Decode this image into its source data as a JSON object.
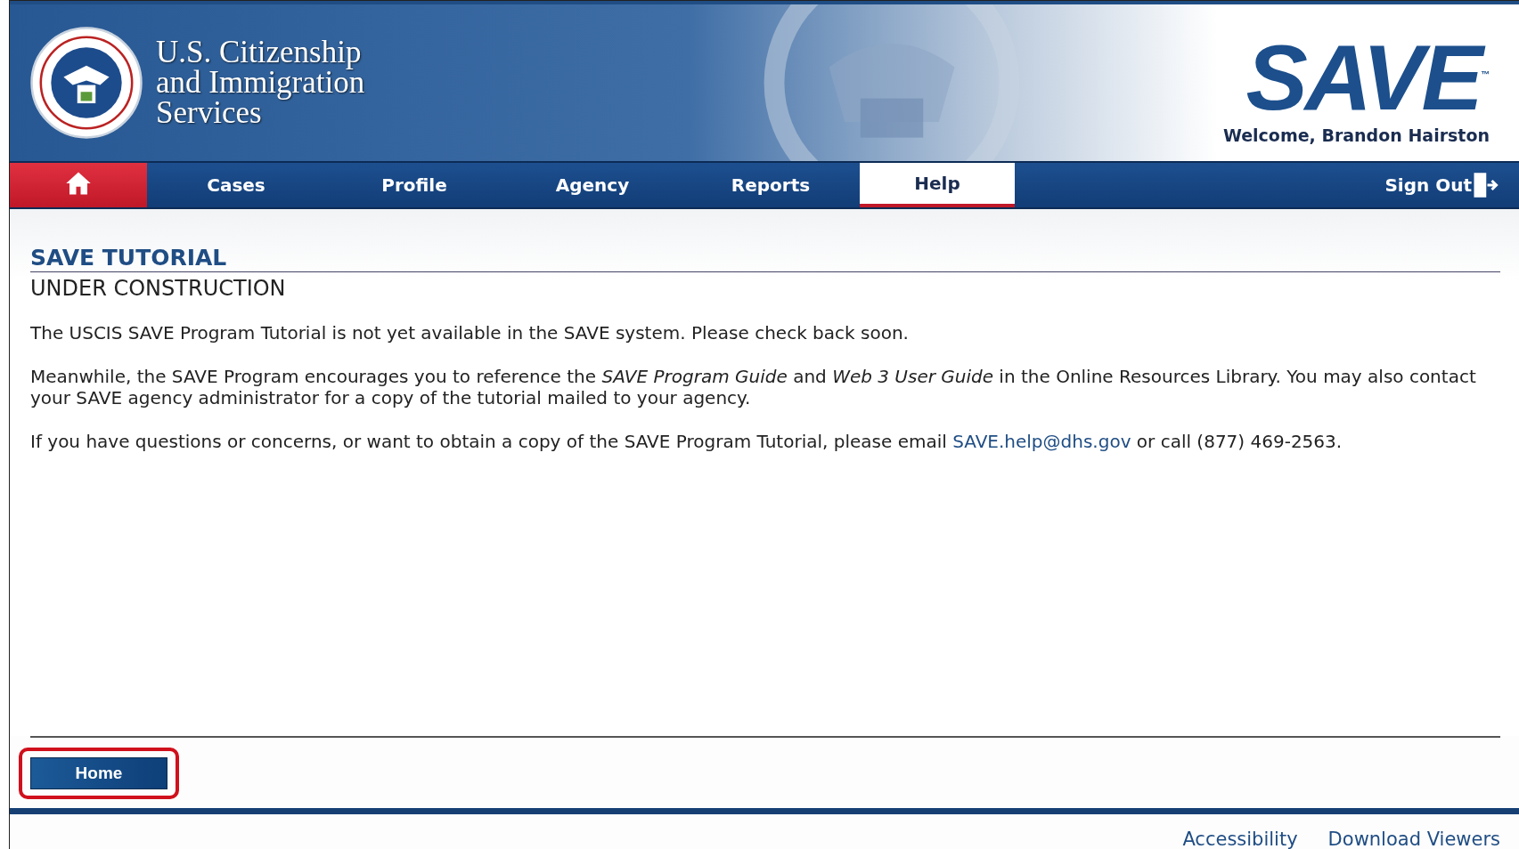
{
  "header": {
    "agency_name": [
      "U.S. Citizenship",
      "and Immigration",
      "Services"
    ],
    "logo_text": "SAVE",
    "trademark": "™",
    "welcome": "Welcome, Brandon Hairston"
  },
  "nav": {
    "items": [
      {
        "kind": "home",
        "selected": false
      },
      {
        "kind": "text",
        "label": "Cases",
        "selected": false
      },
      {
        "kind": "text",
        "label": "Profile",
        "selected": false
      },
      {
        "kind": "text",
        "label": "Agency",
        "selected": false
      },
      {
        "kind": "text",
        "label": "Reports",
        "selected": false
      },
      {
        "kind": "text",
        "label": "Help",
        "selected": true
      }
    ],
    "sign_out": "Sign Out"
  },
  "content": {
    "title": "SAVE TUTORIAL",
    "subtitle": "UNDER CONSTRUCTION",
    "paragraphs": [
      "The USCIS SAVE Program Tutorial is not yet available in the SAVE system. Please check back soon.",
      "Meanwhile, the SAVE Program encourages you to reference the *SAVE Program Guide* and *Web 3 User Guide* in the Online Resources Library. You may also contact your SAVE agency administrator for a copy of the tutorial mailed to your agency."
    ],
    "contact": {
      "before": "If you have questions or concerns, or want to obtain a copy of the SAVE Program Tutorial, please email",
      "email": "SAVE.help@dhs.gov",
      "after": "or call (877) 469-2563."
    }
  },
  "home_button": {
    "label": "Home",
    "highlighted": true
  },
  "footer": {
    "links": [
      "Accessibility",
      "Download Viewers"
    ]
  }
}
